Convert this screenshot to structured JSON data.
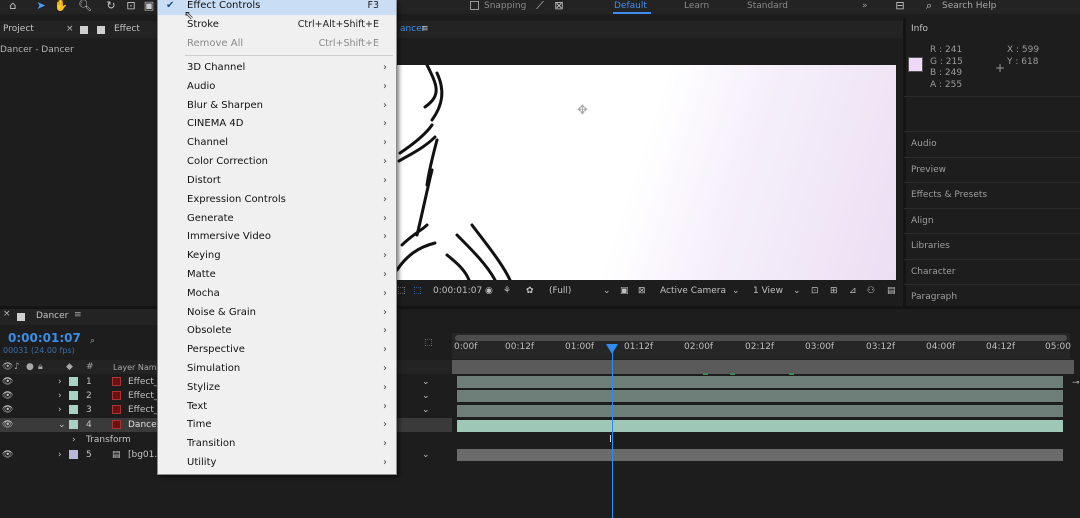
{
  "toolbar": {
    "snapping_label": "Snapping",
    "workspaces": [
      "Default",
      "Learn",
      "Standard"
    ],
    "search_label": "Search Help"
  },
  "project_panel": {
    "tab_label": "Project",
    "effect_tab_label": "Effect Con",
    "subtitle": "Dancer - Dancer"
  },
  "comp_panel": {
    "tab_label": "Dancer"
  },
  "menu": {
    "top_items": [
      {
        "label": "Effect Controls",
        "shortcut": "F3",
        "checked": true
      },
      {
        "label": "Stroke",
        "shortcut": "Ctrl+Alt+Shift+E"
      },
      {
        "label": "Remove All",
        "shortcut": "Ctrl+Shift+E"
      }
    ],
    "categories": [
      "3D Channel",
      "Audio",
      "Blur & Sharpen",
      "CINEMA 4D",
      "Channel",
      "Color Correction",
      "Distort",
      "Expression Controls",
      "Generate",
      "Immersive Video",
      "Keying",
      "Matte",
      "Mocha",
      "Noise & Grain",
      "Obsolete",
      "Perspective",
      "Simulation",
      "Stylize",
      "Text",
      "Time",
      "Transition",
      "Utility"
    ]
  },
  "info": {
    "title": "Info",
    "r": "R : 241",
    "g": "G : 215",
    "b": "B : 249",
    "a": "A : 255",
    "x": "X : 599",
    "y": "Y : 618",
    "swatch_color": "#f1d7f9"
  },
  "right_panels": [
    "Audio",
    "Preview",
    "Effects & Presets",
    "Align",
    "Libraries",
    "Character",
    "Paragraph"
  ],
  "viewer_bar": {
    "timecode": "0:00:01:07",
    "resolution": "(Full)",
    "camera": "Active Camera",
    "view": "1 View"
  },
  "timeline": {
    "tab_label": "Dancer",
    "timecode": "0:00:01:07",
    "fps": "00031 (24.00 fps)",
    "layer_name_header": "Layer Name",
    "ruler_labels": [
      "0:00f",
      "00:12f",
      "01:00f",
      "01:12f",
      "02:00f",
      "02:12f",
      "03:00f",
      "03:12f",
      "04:00f",
      "04:12f",
      "05:00"
    ],
    "layers": [
      {
        "num": "1",
        "name": "Effect_",
        "color": "#a8d3c4"
      },
      {
        "num": "2",
        "name": "Effect_",
        "color": "#a8d3c4"
      },
      {
        "num": "3",
        "name": "Effect_",
        "color": "#a8d3c4"
      },
      {
        "num": "4",
        "name": "Dancer",
        "color": "#a8d3c4"
      },
      {
        "num": "5",
        "name": "[bg01.",
        "color": "#b8b6d9"
      }
    ],
    "transform_label": "Transform"
  },
  "colors": {
    "accent": "#3f8ef0",
    "menu_bg": "#f0f0f0",
    "menu_highlight": "#c9def5"
  }
}
